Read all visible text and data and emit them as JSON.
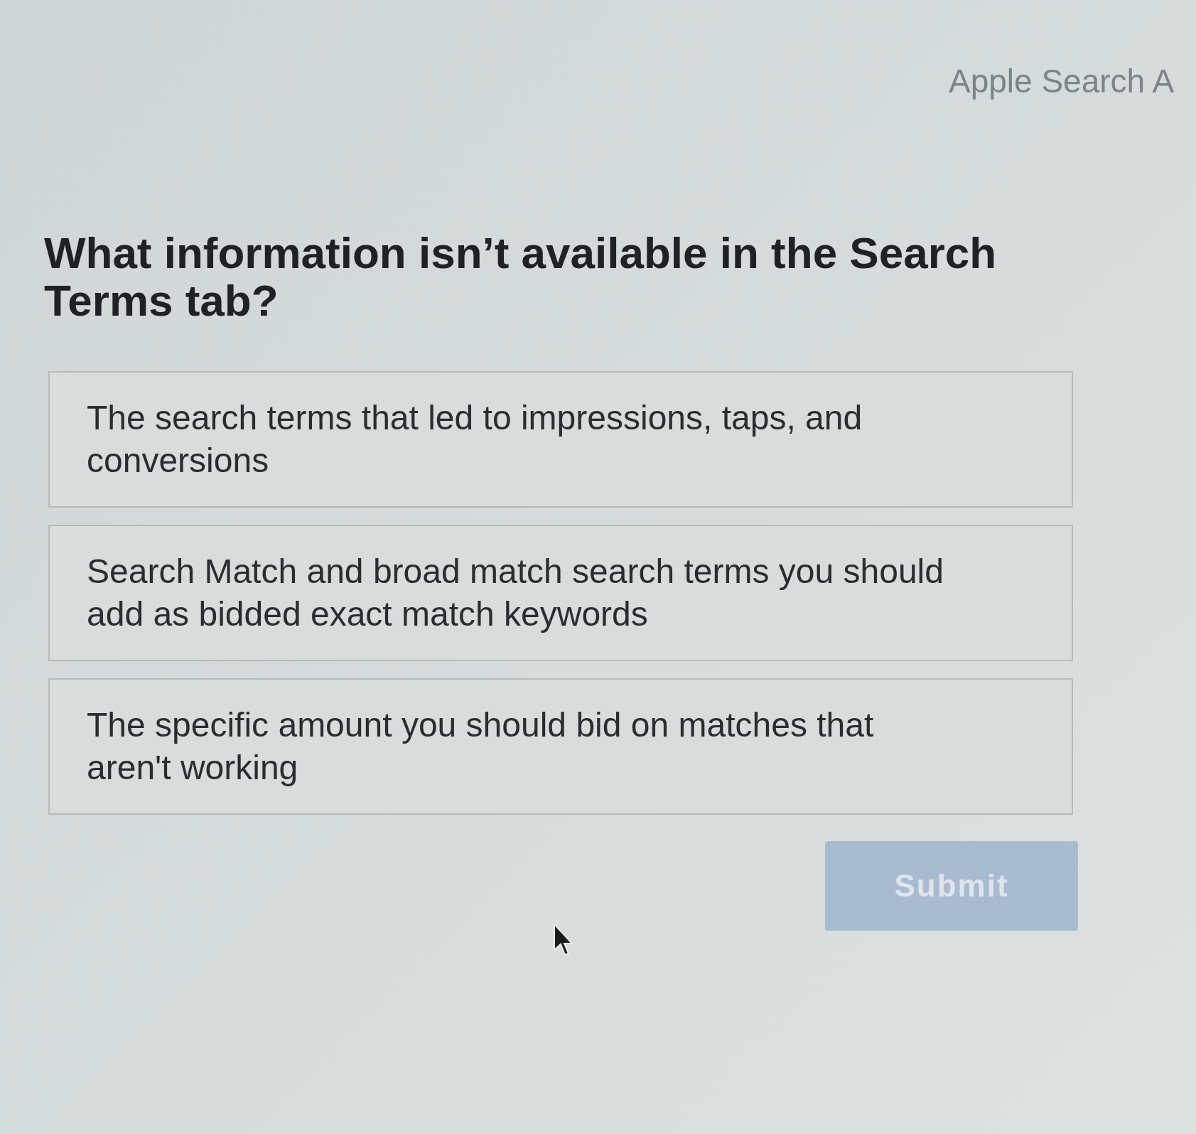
{
  "header": {
    "title": "Apple Search A"
  },
  "question": "What information isn’t available in the Search Terms tab?",
  "options": [
    {
      "text": "The search terms that led to impressions, taps, and conversions",
      "selected": false
    },
    {
      "text": "Search Match and broad match search terms you should add as bidded exact match keywords",
      "selected": false
    },
    {
      "text": "The specific amount you should bid on matches that aren't working",
      "selected": false
    }
  ],
  "submit_button": {
    "label": "Submit",
    "disabled": true
  }
}
